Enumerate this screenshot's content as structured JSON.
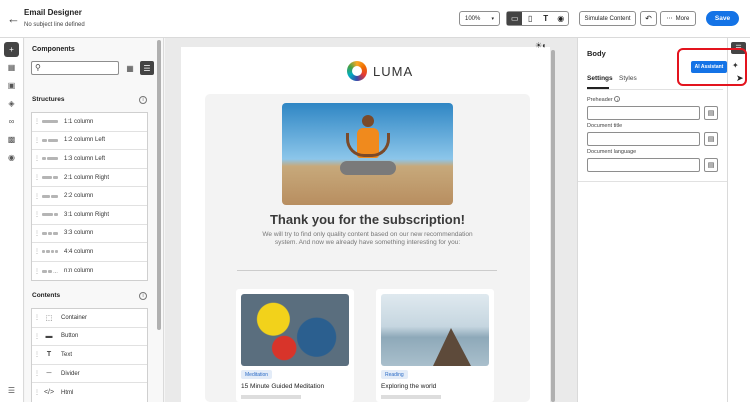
{
  "header": {
    "title": "Email Designer",
    "subtitle": "No subject line defined",
    "zoom": "100%",
    "simulate_label": "Simulate Content",
    "more_label": "More",
    "save_label": "Save"
  },
  "components": {
    "title": "Components",
    "search_placeholder": "",
    "structures_label": "Structures",
    "structures": [
      "1:1 column",
      "1:2 column Left",
      "1:3 column Left",
      "2:1 column Right",
      "2:2 column",
      "3:1 column Right",
      "3:3 column",
      "4:4 column",
      "n:n column"
    ],
    "contents_label": "Contents",
    "contents": [
      {
        "label": "Container",
        "icon": "container-icon"
      },
      {
        "label": "Button",
        "icon": "button-icon"
      },
      {
        "label": "Text",
        "icon": "text-icon"
      },
      {
        "label": "Divider",
        "icon": "divider-icon"
      },
      {
        "label": "Html",
        "icon": "html-icon"
      }
    ]
  },
  "email": {
    "brand": "LUMA",
    "heading": "Thank you for the subscription!",
    "description": "We will try to find only quality content based on our new recommendation system. And now we already have something interesting for you:",
    "cards": [
      {
        "tag": "Meditation",
        "title": "15 Minute Guided Meditation"
      },
      {
        "tag": "Reading",
        "title": "Exploring the world"
      }
    ]
  },
  "properties": {
    "title": "Body",
    "tabs": [
      "Settings",
      "Styles"
    ],
    "active_tab": "Settings",
    "fields": [
      {
        "label": "Preheader",
        "value": ""
      },
      {
        "label": "Document title",
        "value": ""
      },
      {
        "label": "Document language",
        "value": ""
      }
    ],
    "ai_assistant_label": "AI Assistant"
  },
  "colors": {
    "accent": "#1473e6",
    "highlight": "#e3141e"
  }
}
